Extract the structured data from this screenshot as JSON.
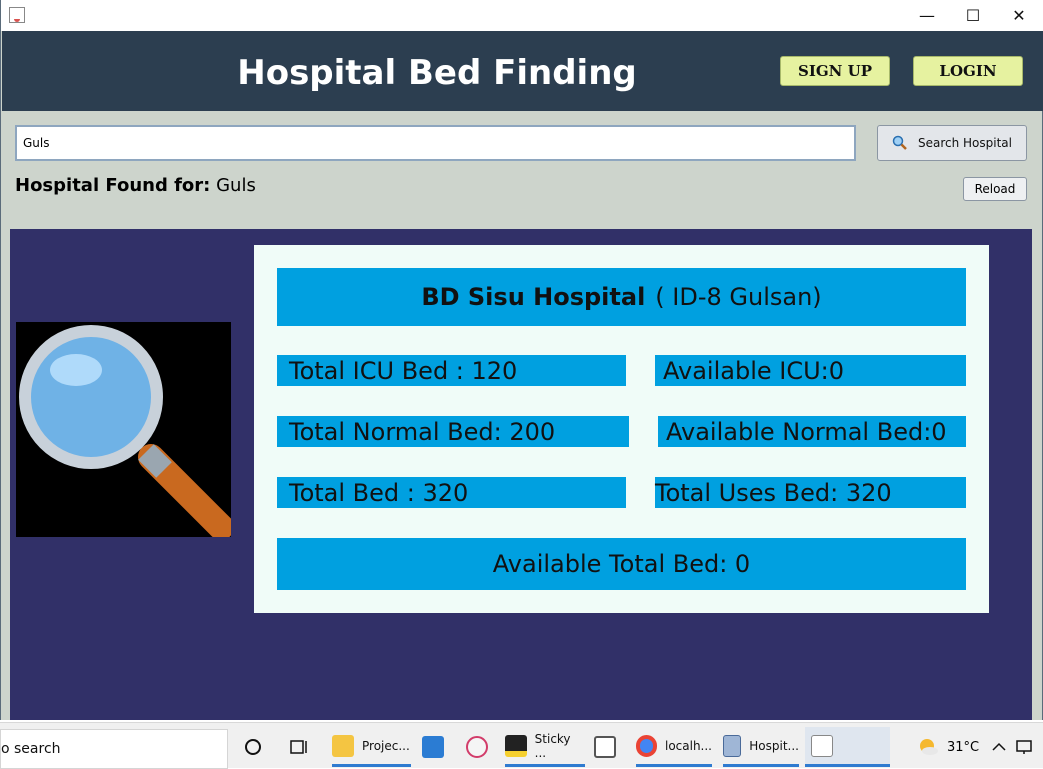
{
  "window": {
    "minimize": "—",
    "maximize": "☐",
    "close": "✕"
  },
  "header": {
    "title": "Hospital Bed Finding",
    "signup_label": "SIGN UP",
    "login_label": "LOGIN"
  },
  "search": {
    "value": "Guls",
    "button_label": "Search Hospital",
    "found_label": "Hospital Found for:",
    "found_value": "Guls",
    "reload_label": "Reload"
  },
  "hospital": {
    "name": "BD Sisu Hospital",
    "id_text": "( ID-8 Gulsan)",
    "total_icu": "Total ICU Bed : 120",
    "available_icu": "Available ICU:0",
    "total_normal": "Total Normal Bed: 200",
    "available_normal": "Available Normal Bed:0",
    "total_bed": "Total Bed : 320",
    "total_uses": "Total Uses Bed: 320",
    "available_total": "Available Total Bed: 0"
  },
  "colors": {
    "header_bg": "#2c3e50",
    "results_bg": "#313068",
    "cell_bg": "#00a0e0",
    "button_bg": "#e6f2a0"
  },
  "taskbar": {
    "search_text": "o search",
    "items": [
      {
        "label": "Projec...",
        "icon": "folder-icon"
      },
      {
        "label": "",
        "icon": "mail-icon"
      },
      {
        "label": "",
        "icon": "snip-icon"
      },
      {
        "label": "Sticky ...",
        "icon": "sticky-notes-icon"
      },
      {
        "label": "",
        "icon": "presentation-icon"
      },
      {
        "label": "localh...",
        "icon": "chrome-icon"
      },
      {
        "label": "Hospit...",
        "icon": "cube-icon"
      },
      {
        "label": "",
        "icon": "java-icon"
      }
    ],
    "temperature": "31°C"
  }
}
